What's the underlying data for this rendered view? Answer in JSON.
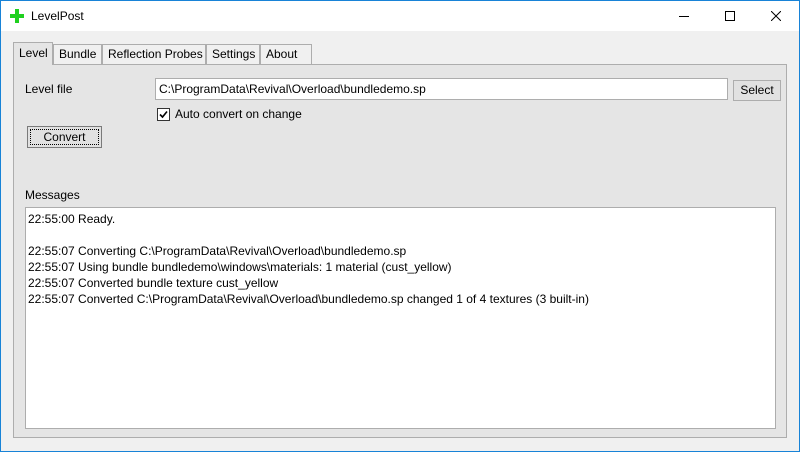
{
  "window": {
    "title": "LevelPost",
    "icon": "green-plus-icon",
    "accent_color": "#1883d7",
    "controls": [
      "minimize-icon",
      "maximize-icon",
      "close-icon"
    ]
  },
  "tabs": [
    {
      "label": "Level",
      "active": true
    },
    {
      "label": "Bundle",
      "active": false
    },
    {
      "label": "Reflection Probes",
      "active": false
    },
    {
      "label": "Settings",
      "active": false
    },
    {
      "label": "About",
      "active": false
    }
  ],
  "level": {
    "file_label": "Level file",
    "file_value": "C:\\ProgramData\\Revival\\Overload\\bundledemo.sp",
    "select_label": "Select",
    "auto_convert_label": "Auto convert on change",
    "auto_convert_checked": true,
    "convert_label": "Convert",
    "messages_label": "Messages",
    "messages": [
      "22:55:00 Ready.",
      "",
      "22:55:07 Converting C:\\ProgramData\\Revival\\Overload\\bundledemo.sp",
      "22:55:07 Using bundle bundledemo\\windows\\materials: 1 material (cust_yellow)",
      "22:55:07 Converted bundle texture cust_yellow",
      "22:55:07 Converted C:\\ProgramData\\Revival\\Overload\\bundledemo.sp changed 1 of 4 textures (3 built-in)"
    ]
  }
}
